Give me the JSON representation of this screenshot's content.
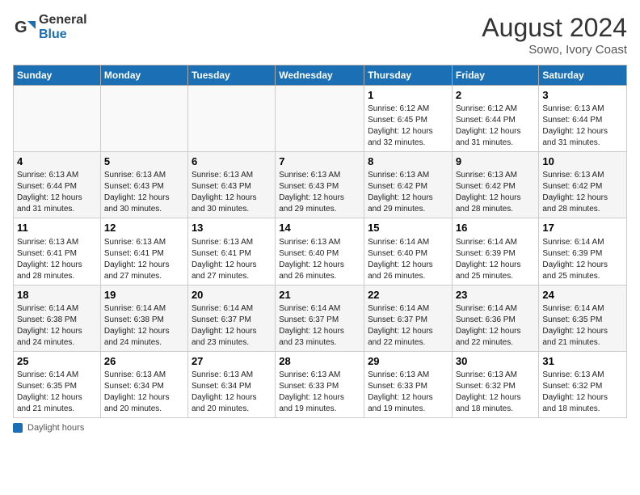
{
  "header": {
    "logo_line1": "General",
    "logo_line2": "Blue",
    "month_year": "August 2024",
    "location": "Sowo, Ivory Coast"
  },
  "days": [
    "Sunday",
    "Monday",
    "Tuesday",
    "Wednesday",
    "Thursday",
    "Friday",
    "Saturday"
  ],
  "weeks": [
    [
      {
        "date": "",
        "info": ""
      },
      {
        "date": "",
        "info": ""
      },
      {
        "date": "",
        "info": ""
      },
      {
        "date": "",
        "info": ""
      },
      {
        "date": "1",
        "info": "Sunrise: 6:12 AM\nSunset: 6:45 PM\nDaylight: 12 hours\nand 32 minutes."
      },
      {
        "date": "2",
        "info": "Sunrise: 6:12 AM\nSunset: 6:44 PM\nDaylight: 12 hours\nand 31 minutes."
      },
      {
        "date": "3",
        "info": "Sunrise: 6:13 AM\nSunset: 6:44 PM\nDaylight: 12 hours\nand 31 minutes."
      }
    ],
    [
      {
        "date": "4",
        "info": "Sunrise: 6:13 AM\nSunset: 6:44 PM\nDaylight: 12 hours\nand 31 minutes."
      },
      {
        "date": "5",
        "info": "Sunrise: 6:13 AM\nSunset: 6:43 PM\nDaylight: 12 hours\nand 30 minutes."
      },
      {
        "date": "6",
        "info": "Sunrise: 6:13 AM\nSunset: 6:43 PM\nDaylight: 12 hours\nand 30 minutes."
      },
      {
        "date": "7",
        "info": "Sunrise: 6:13 AM\nSunset: 6:43 PM\nDaylight: 12 hours\nand 29 minutes."
      },
      {
        "date": "8",
        "info": "Sunrise: 6:13 AM\nSunset: 6:42 PM\nDaylight: 12 hours\nand 29 minutes."
      },
      {
        "date": "9",
        "info": "Sunrise: 6:13 AM\nSunset: 6:42 PM\nDaylight: 12 hours\nand 28 minutes."
      },
      {
        "date": "10",
        "info": "Sunrise: 6:13 AM\nSunset: 6:42 PM\nDaylight: 12 hours\nand 28 minutes."
      }
    ],
    [
      {
        "date": "11",
        "info": "Sunrise: 6:13 AM\nSunset: 6:41 PM\nDaylight: 12 hours\nand 28 minutes."
      },
      {
        "date": "12",
        "info": "Sunrise: 6:13 AM\nSunset: 6:41 PM\nDaylight: 12 hours\nand 27 minutes."
      },
      {
        "date": "13",
        "info": "Sunrise: 6:13 AM\nSunset: 6:41 PM\nDaylight: 12 hours\nand 27 minutes."
      },
      {
        "date": "14",
        "info": "Sunrise: 6:13 AM\nSunset: 6:40 PM\nDaylight: 12 hours\nand 26 minutes."
      },
      {
        "date": "15",
        "info": "Sunrise: 6:14 AM\nSunset: 6:40 PM\nDaylight: 12 hours\nand 26 minutes."
      },
      {
        "date": "16",
        "info": "Sunrise: 6:14 AM\nSunset: 6:39 PM\nDaylight: 12 hours\nand 25 minutes."
      },
      {
        "date": "17",
        "info": "Sunrise: 6:14 AM\nSunset: 6:39 PM\nDaylight: 12 hours\nand 25 minutes."
      }
    ],
    [
      {
        "date": "18",
        "info": "Sunrise: 6:14 AM\nSunset: 6:38 PM\nDaylight: 12 hours\nand 24 minutes."
      },
      {
        "date": "19",
        "info": "Sunrise: 6:14 AM\nSunset: 6:38 PM\nDaylight: 12 hours\nand 24 minutes."
      },
      {
        "date": "20",
        "info": "Sunrise: 6:14 AM\nSunset: 6:37 PM\nDaylight: 12 hours\nand 23 minutes."
      },
      {
        "date": "21",
        "info": "Sunrise: 6:14 AM\nSunset: 6:37 PM\nDaylight: 12 hours\nand 23 minutes."
      },
      {
        "date": "22",
        "info": "Sunrise: 6:14 AM\nSunset: 6:37 PM\nDaylight: 12 hours\nand 22 minutes."
      },
      {
        "date": "23",
        "info": "Sunrise: 6:14 AM\nSunset: 6:36 PM\nDaylight: 12 hours\nand 22 minutes."
      },
      {
        "date": "24",
        "info": "Sunrise: 6:14 AM\nSunset: 6:35 PM\nDaylight: 12 hours\nand 21 minutes."
      }
    ],
    [
      {
        "date": "25",
        "info": "Sunrise: 6:14 AM\nSunset: 6:35 PM\nDaylight: 12 hours\nand 21 minutes."
      },
      {
        "date": "26",
        "info": "Sunrise: 6:13 AM\nSunset: 6:34 PM\nDaylight: 12 hours\nand 20 minutes."
      },
      {
        "date": "27",
        "info": "Sunrise: 6:13 AM\nSunset: 6:34 PM\nDaylight: 12 hours\nand 20 minutes."
      },
      {
        "date": "28",
        "info": "Sunrise: 6:13 AM\nSunset: 6:33 PM\nDaylight: 12 hours\nand 19 minutes."
      },
      {
        "date": "29",
        "info": "Sunrise: 6:13 AM\nSunset: 6:33 PM\nDaylight: 12 hours\nand 19 minutes."
      },
      {
        "date": "30",
        "info": "Sunrise: 6:13 AM\nSunset: 6:32 PM\nDaylight: 12 hours\nand 18 minutes."
      },
      {
        "date": "31",
        "info": "Sunrise: 6:13 AM\nSunset: 6:32 PM\nDaylight: 12 hours\nand 18 minutes."
      }
    ]
  ],
  "footer": {
    "label": "Daylight hours"
  }
}
